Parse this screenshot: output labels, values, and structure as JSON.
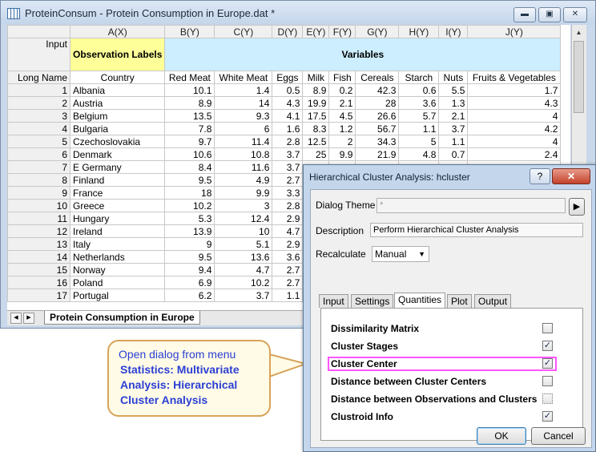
{
  "window": {
    "title": "ProteinConsum - Protein Consumption in Europe.dat *",
    "min_glyph": "▬",
    "restore_glyph": "▣",
    "close_glyph": "✕"
  },
  "sheet_tab": "Protein Consumption in Europe",
  "grid": {
    "columns": [
      "A(X)",
      "B(Y)",
      "C(Y)",
      "D(Y)",
      "E(Y)",
      "F(Y)",
      "G(Y)",
      "H(Y)",
      "I(Y)",
      "J(Y)"
    ],
    "input_label": "Input",
    "observation_labels": "Observation Labels",
    "variables_label": "Variables",
    "long_name_label": "Long Name",
    "long_names": [
      "Country",
      "Red Meat",
      "White Meat",
      "Eggs",
      "Milk",
      "Fish",
      "Cereals",
      "Starch",
      "Nuts",
      "Fruits & Vegetables"
    ],
    "rows": [
      {
        "n": "1",
        "cells": [
          "Albania",
          "10.1",
          "1.4",
          "0.5",
          "8.9",
          "0.2",
          "42.3",
          "0.6",
          "5.5",
          "1.7"
        ]
      },
      {
        "n": "2",
        "cells": [
          "Austria",
          "8.9",
          "14",
          "4.3",
          "19.9",
          "2.1",
          "28",
          "3.6",
          "1.3",
          "4.3"
        ]
      },
      {
        "n": "3",
        "cells": [
          "Belgium",
          "13.5",
          "9.3",
          "4.1",
          "17.5",
          "4.5",
          "26.6",
          "5.7",
          "2.1",
          "4"
        ]
      },
      {
        "n": "4",
        "cells": [
          "Bulgaria",
          "7.8",
          "6",
          "1.6",
          "8.3",
          "1.2",
          "56.7",
          "1.1",
          "3.7",
          "4.2"
        ]
      },
      {
        "n": "5",
        "cells": [
          "Czechoslovakia",
          "9.7",
          "11.4",
          "2.8",
          "12.5",
          "2",
          "34.3",
          "5",
          "1.1",
          "4"
        ]
      },
      {
        "n": "6",
        "cells": [
          "Denmark",
          "10.6",
          "10.8",
          "3.7",
          "25",
          "9.9",
          "21.9",
          "4.8",
          "0.7",
          "2.4"
        ]
      },
      {
        "n": "7",
        "cells": [
          "E Germany",
          "8.4",
          "11.6",
          "3.7",
          "",
          "",
          "",
          "",
          "",
          ""
        ]
      },
      {
        "n": "8",
        "cells": [
          "Finland",
          "9.5",
          "4.9",
          "2.7",
          "",
          "",
          "",
          "",
          "",
          ""
        ]
      },
      {
        "n": "9",
        "cells": [
          "France",
          "18",
          "9.9",
          "3.3",
          "",
          "",
          "",
          "",
          "",
          ""
        ]
      },
      {
        "n": "10",
        "cells": [
          "Greece",
          "10.2",
          "3",
          "2.8",
          "",
          "",
          "",
          "",
          "",
          ""
        ]
      },
      {
        "n": "11",
        "cells": [
          "Hungary",
          "5.3",
          "12.4",
          "2.9",
          "",
          "",
          "",
          "",
          "",
          ""
        ]
      },
      {
        "n": "12",
        "cells": [
          "Ireland",
          "13.9",
          "10",
          "4.7",
          "",
          "",
          "",
          "",
          "",
          ""
        ]
      },
      {
        "n": "13",
        "cells": [
          "Italy",
          "9",
          "5.1",
          "2.9",
          "",
          "",
          "",
          "",
          "",
          ""
        ]
      },
      {
        "n": "14",
        "cells": [
          "Netherlands",
          "9.5",
          "13.6",
          "3.6",
          "",
          "",
          "",
          "",
          "",
          ""
        ]
      },
      {
        "n": "15",
        "cells": [
          "Norway",
          "9.4",
          "4.7",
          "2.7",
          "",
          "",
          "",
          "",
          "",
          ""
        ]
      },
      {
        "n": "16",
        "cells": [
          "Poland",
          "6.9",
          "10.2",
          "2.7",
          "",
          "",
          "",
          "",
          "",
          ""
        ]
      },
      {
        "n": "17",
        "cells": [
          "Portugal",
          "6.2",
          "3.7",
          "1.1",
          "",
          "",
          "",
          "",
          "",
          ""
        ]
      }
    ]
  },
  "dialog": {
    "title": "Hierarchical Cluster Analysis: hcluster",
    "help_label": "?",
    "close_label": "✕",
    "theme_label": "Dialog Theme",
    "theme_value": "*",
    "theme_arrow": "▶",
    "description_label": "Description",
    "description_value": "Perform Hierarchical Cluster Analysis",
    "recalculate_label": "Recalculate",
    "recalculate_value": "Manual",
    "tabs": [
      "Input",
      "Settings",
      "Quantities",
      "Plot",
      "Output"
    ],
    "active_tab": "Quantities",
    "quantities": [
      {
        "label": "Dissimilarity Matrix",
        "checked": false
      },
      {
        "label": "Cluster Stages",
        "checked": true
      },
      {
        "label": "Cluster Center",
        "checked": true
      },
      {
        "label": "Distance between Cluster Centers",
        "checked": false
      },
      {
        "label": "Distance between Observations and Clusters",
        "checked": false
      },
      {
        "label": "Clustroid Info",
        "checked": true
      }
    ],
    "ok_label": "OK",
    "cancel_label": "Cancel"
  },
  "callout": {
    "line1": "Open dialog from menu",
    "line2": "Statistics: Multivariate Analysis: Hierarchical Cluster Analysis"
  },
  "colors": {
    "observation_labels_bg": "#ffff99",
    "variables_bg": "#cceeff",
    "highlight": "#ff55ff"
  }
}
